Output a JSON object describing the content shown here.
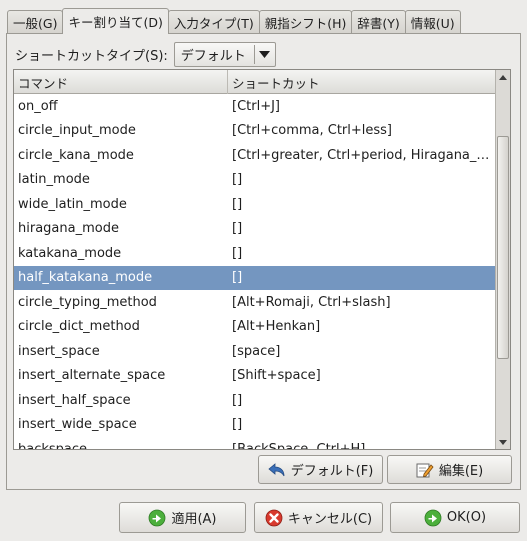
{
  "tabs": [
    {
      "label": "一般(G)"
    },
    {
      "label": "キー割り当て(D)"
    },
    {
      "label": "入力タイプ(T)"
    },
    {
      "label": "親指シフト(H)"
    },
    {
      "label": "辞書(Y)"
    },
    {
      "label": "情報(U)"
    }
  ],
  "active_tab": "キー割り当て(D)",
  "shortcut_type": {
    "label": "ショートカットタイプ(S):",
    "value": "デフォルト"
  },
  "table": {
    "headers": [
      "コマンド",
      "ショートカット"
    ],
    "rows": [
      {
        "command": "on_off",
        "shortcut": "[Ctrl+J]"
      },
      {
        "command": "circle_input_mode",
        "shortcut": "[Ctrl+comma, Ctrl+less]"
      },
      {
        "command": "circle_kana_mode",
        "shortcut": "[Ctrl+greater, Ctrl+period, Hiragana_K…"
      },
      {
        "command": "latin_mode",
        "shortcut": "[]"
      },
      {
        "command": "wide_latin_mode",
        "shortcut": "[]"
      },
      {
        "command": "hiragana_mode",
        "shortcut": "[]"
      },
      {
        "command": "katakana_mode",
        "shortcut": "[]"
      },
      {
        "command": "half_katakana_mode",
        "shortcut": "[]"
      },
      {
        "command": "circle_typing_method",
        "shortcut": "[Alt+Romaji, Ctrl+slash]"
      },
      {
        "command": "circle_dict_method",
        "shortcut": "[Alt+Henkan]"
      },
      {
        "command": "insert_space",
        "shortcut": "[space]"
      },
      {
        "command": "insert_alternate_space",
        "shortcut": "[Shift+space]"
      },
      {
        "command": "insert_half_space",
        "shortcut": "[]"
      },
      {
        "command": "insert_wide_space",
        "shortcut": "[]"
      },
      {
        "command": "backspace",
        "shortcut": "[BackSpace, Ctrl+H]"
      }
    ],
    "selected_row": "half_katakana_mode"
  },
  "panel_buttons": {
    "default_label": "デフォルト(F)",
    "edit_label": "編集(E)"
  },
  "dialog_buttons": {
    "apply_label": "適用(A)",
    "cancel_label": "キャンセル(C)",
    "ok_label": "OK(O)"
  },
  "colors": {
    "selection": "#7496c0",
    "ok_green": "#4caf3c",
    "cancel_red": "#d83a2e"
  }
}
